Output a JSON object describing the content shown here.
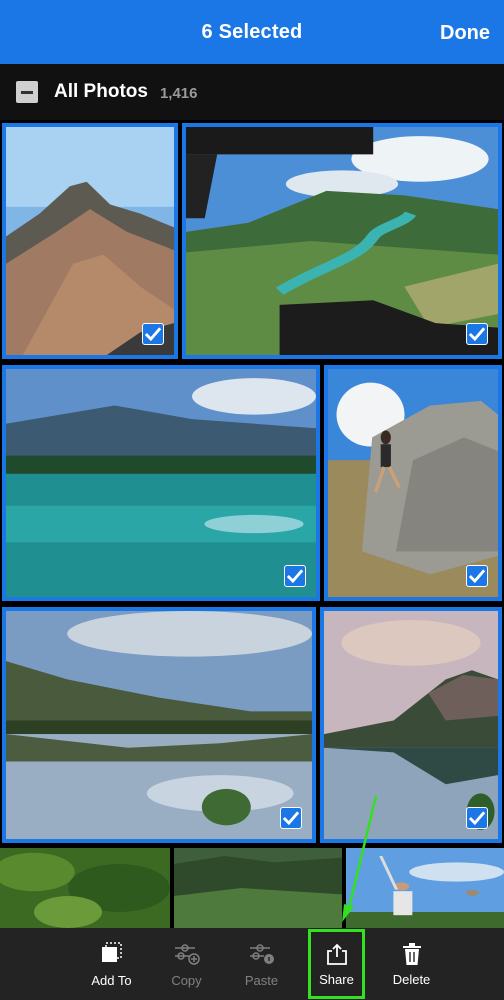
{
  "header": {
    "title": "6 Selected",
    "done_label": "Done"
  },
  "album": {
    "name": "All Photos",
    "count": "1,416"
  },
  "photos": [
    {
      "name": "mountain-peak",
      "selected": true
    },
    {
      "name": "river-valley",
      "selected": true
    },
    {
      "name": "turquoise-lake",
      "selected": true
    },
    {
      "name": "rock-climber",
      "selected": true
    },
    {
      "name": "lake-reflection",
      "selected": true
    },
    {
      "name": "sunset-lake",
      "selected": true
    },
    {
      "name": "forest-trees",
      "selected": false
    },
    {
      "name": "forest-hillside",
      "selected": false
    },
    {
      "name": "golfer",
      "selected": false
    }
  ],
  "toolbar": {
    "add_to": "Add To",
    "copy": "Copy",
    "paste": "Paste",
    "share": "Share",
    "delete": "Delete"
  },
  "colors": {
    "accent": "#1b76e6",
    "highlight": "#34e01f",
    "toolbar": "#232323"
  }
}
